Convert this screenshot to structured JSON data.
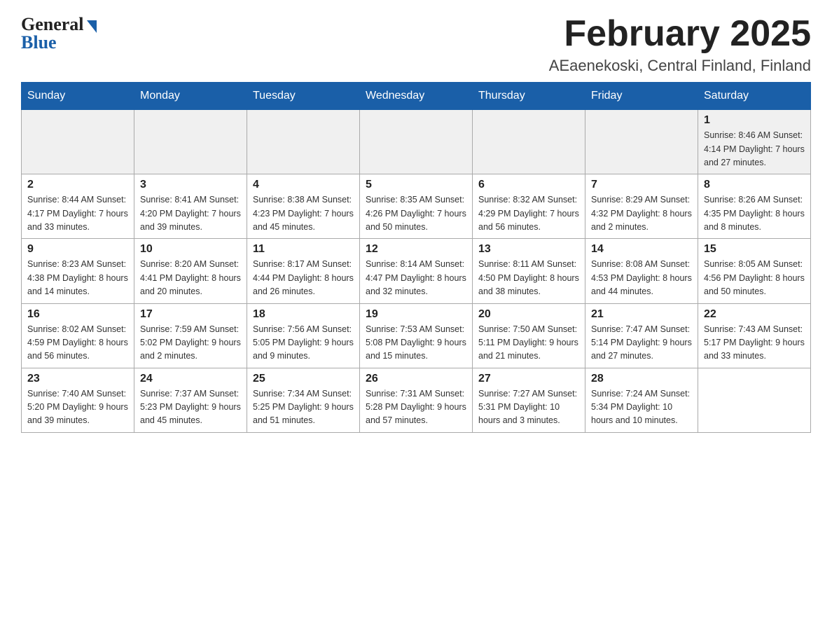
{
  "header": {
    "logo_general": "General",
    "logo_blue": "Blue",
    "month_title": "February 2025",
    "location": "AEaenekoski, Central Finland, Finland"
  },
  "weekdays": [
    "Sunday",
    "Monday",
    "Tuesday",
    "Wednesday",
    "Thursday",
    "Friday",
    "Saturday"
  ],
  "weeks": [
    [
      {
        "day": "",
        "info": ""
      },
      {
        "day": "",
        "info": ""
      },
      {
        "day": "",
        "info": ""
      },
      {
        "day": "",
        "info": ""
      },
      {
        "day": "",
        "info": ""
      },
      {
        "day": "",
        "info": ""
      },
      {
        "day": "1",
        "info": "Sunrise: 8:46 AM\nSunset: 4:14 PM\nDaylight: 7 hours\nand 27 minutes."
      }
    ],
    [
      {
        "day": "2",
        "info": "Sunrise: 8:44 AM\nSunset: 4:17 PM\nDaylight: 7 hours\nand 33 minutes."
      },
      {
        "day": "3",
        "info": "Sunrise: 8:41 AM\nSunset: 4:20 PM\nDaylight: 7 hours\nand 39 minutes."
      },
      {
        "day": "4",
        "info": "Sunrise: 8:38 AM\nSunset: 4:23 PM\nDaylight: 7 hours\nand 45 minutes."
      },
      {
        "day": "5",
        "info": "Sunrise: 8:35 AM\nSunset: 4:26 PM\nDaylight: 7 hours\nand 50 minutes."
      },
      {
        "day": "6",
        "info": "Sunrise: 8:32 AM\nSunset: 4:29 PM\nDaylight: 7 hours\nand 56 minutes."
      },
      {
        "day": "7",
        "info": "Sunrise: 8:29 AM\nSunset: 4:32 PM\nDaylight: 8 hours\nand 2 minutes."
      },
      {
        "day": "8",
        "info": "Sunrise: 8:26 AM\nSunset: 4:35 PM\nDaylight: 8 hours\nand 8 minutes."
      }
    ],
    [
      {
        "day": "9",
        "info": "Sunrise: 8:23 AM\nSunset: 4:38 PM\nDaylight: 8 hours\nand 14 minutes."
      },
      {
        "day": "10",
        "info": "Sunrise: 8:20 AM\nSunset: 4:41 PM\nDaylight: 8 hours\nand 20 minutes."
      },
      {
        "day": "11",
        "info": "Sunrise: 8:17 AM\nSunset: 4:44 PM\nDaylight: 8 hours\nand 26 minutes."
      },
      {
        "day": "12",
        "info": "Sunrise: 8:14 AM\nSunset: 4:47 PM\nDaylight: 8 hours\nand 32 minutes."
      },
      {
        "day": "13",
        "info": "Sunrise: 8:11 AM\nSunset: 4:50 PM\nDaylight: 8 hours\nand 38 minutes."
      },
      {
        "day": "14",
        "info": "Sunrise: 8:08 AM\nSunset: 4:53 PM\nDaylight: 8 hours\nand 44 minutes."
      },
      {
        "day": "15",
        "info": "Sunrise: 8:05 AM\nSunset: 4:56 PM\nDaylight: 8 hours\nand 50 minutes."
      }
    ],
    [
      {
        "day": "16",
        "info": "Sunrise: 8:02 AM\nSunset: 4:59 PM\nDaylight: 8 hours\nand 56 minutes."
      },
      {
        "day": "17",
        "info": "Sunrise: 7:59 AM\nSunset: 5:02 PM\nDaylight: 9 hours\nand 2 minutes."
      },
      {
        "day": "18",
        "info": "Sunrise: 7:56 AM\nSunset: 5:05 PM\nDaylight: 9 hours\nand 9 minutes."
      },
      {
        "day": "19",
        "info": "Sunrise: 7:53 AM\nSunset: 5:08 PM\nDaylight: 9 hours\nand 15 minutes."
      },
      {
        "day": "20",
        "info": "Sunrise: 7:50 AM\nSunset: 5:11 PM\nDaylight: 9 hours\nand 21 minutes."
      },
      {
        "day": "21",
        "info": "Sunrise: 7:47 AM\nSunset: 5:14 PM\nDaylight: 9 hours\nand 27 minutes."
      },
      {
        "day": "22",
        "info": "Sunrise: 7:43 AM\nSunset: 5:17 PM\nDaylight: 9 hours\nand 33 minutes."
      }
    ],
    [
      {
        "day": "23",
        "info": "Sunrise: 7:40 AM\nSunset: 5:20 PM\nDaylight: 9 hours\nand 39 minutes."
      },
      {
        "day": "24",
        "info": "Sunrise: 7:37 AM\nSunset: 5:23 PM\nDaylight: 9 hours\nand 45 minutes."
      },
      {
        "day": "25",
        "info": "Sunrise: 7:34 AM\nSunset: 5:25 PM\nDaylight: 9 hours\nand 51 minutes."
      },
      {
        "day": "26",
        "info": "Sunrise: 7:31 AM\nSunset: 5:28 PM\nDaylight: 9 hours\nand 57 minutes."
      },
      {
        "day": "27",
        "info": "Sunrise: 7:27 AM\nSunset: 5:31 PM\nDaylight: 10 hours\nand 3 minutes."
      },
      {
        "day": "28",
        "info": "Sunrise: 7:24 AM\nSunset: 5:34 PM\nDaylight: 10 hours\nand 10 minutes."
      },
      {
        "day": "",
        "info": ""
      }
    ]
  ]
}
